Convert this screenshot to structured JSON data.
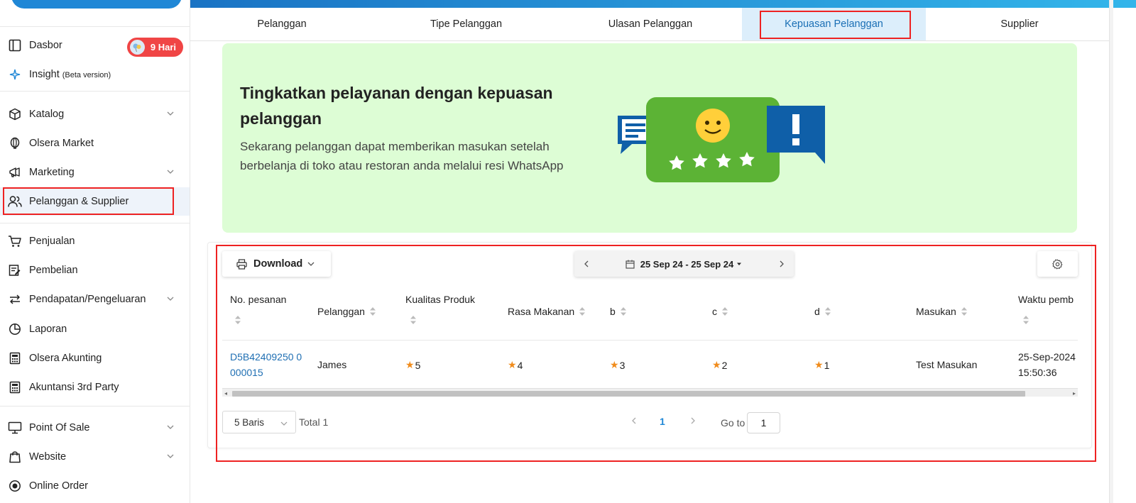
{
  "sidebar": {
    "badge": "9 Hari",
    "items": [
      {
        "label": "Dasbor"
      },
      {
        "label": "Insight",
        "beta": "(Beta version)"
      },
      {
        "label": "Katalog"
      },
      {
        "label": "Olsera Market"
      },
      {
        "label": "Marketing"
      },
      {
        "label": "Pelanggan & Supplier"
      },
      {
        "label": "Penjualan"
      },
      {
        "label": "Pembelian"
      },
      {
        "label": "Pendapatan/Pengeluaran"
      },
      {
        "label": "Laporan"
      },
      {
        "label": "Olsera Akunting"
      },
      {
        "label": "Akuntansi 3rd Party"
      },
      {
        "label": "Point Of Sale"
      },
      {
        "label": "Website"
      },
      {
        "label": "Online Order"
      }
    ]
  },
  "tabs": [
    "Pelanggan",
    "Tipe Pelanggan",
    "Ulasan Pelanggan",
    "Kepuasan Pelanggan",
    "Supplier"
  ],
  "banner": {
    "title": "Tingkatkan pelayanan dengan kepuasan pelanggan",
    "text": "Sekarang pelanggan dapat memberikan masukan setelah berbelanja di toko atau restoran anda melalui resi WhatsApp"
  },
  "toolbar": {
    "download_label": "Download",
    "date_range": "25 Sep 24 - 25 Sep 24"
  },
  "table": {
    "headers": {
      "order_no": "No. pesanan",
      "customer": "Pelanggan",
      "product_quality": "Kualitas Produk",
      "food_taste": "Rasa Makanan",
      "b": "b",
      "c": "c",
      "d": "d",
      "feedback": "Masukan",
      "time": "Waktu pemb"
    },
    "rows": [
      {
        "order_no": "D5B42409250 0000015",
        "customer": "James",
        "product_quality": "5",
        "food_taste": "4",
        "b": "3",
        "c": "2",
        "d": "1",
        "feedback": "Test Masukan",
        "date": "25-Sep-2024",
        "time": "15:50:36"
      }
    ]
  },
  "pagination": {
    "rows_per_page": "5 Baris",
    "total": "Total 1",
    "current_page": "1",
    "goto_label": "Go to",
    "goto_value": "1"
  },
  "colors": {
    "accent": "#1f87d6",
    "badge": "#f04545",
    "banner_bg": "#ddfdd5",
    "highlight": "#e22222",
    "star": "#f08c1c"
  }
}
